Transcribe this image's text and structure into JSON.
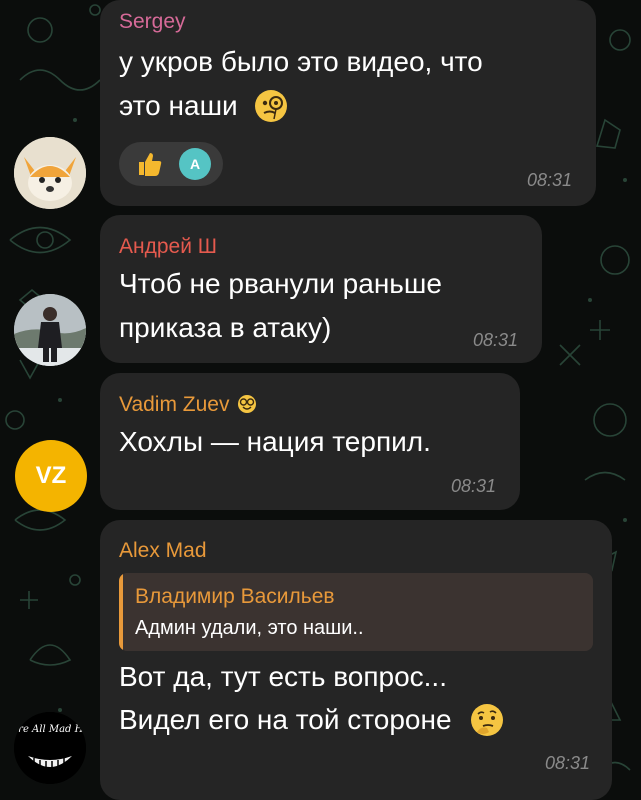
{
  "colors": {
    "background": "#0b0d0c",
    "bubble": "#252525",
    "sergey": "#d66a98",
    "andrey": "#e55a4e",
    "vadim": "#e8993a",
    "alex": "#e8993a",
    "reply_name": "#e8993a",
    "reply_bar": "#e8993a",
    "avatar_vz": "#f4b400",
    "reaction_avatar": "#55c4c4"
  },
  "messages": [
    {
      "sender": "Sergey",
      "lines": [
        "у укров было это видео, что",
        "это наши"
      ],
      "emoji": "monocle-face-icon",
      "reactions": [
        {
          "icon": "thumbs-up-icon"
        },
        {
          "avatar_letter": "A"
        }
      ],
      "time": "08:31"
    },
    {
      "sender": "Андрей Ш",
      "lines": [
        "Чтоб не рванули раньше",
        "приказа в атаку)"
      ],
      "time": "08:31"
    },
    {
      "sender": "Vadim Zuev",
      "sender_badge": "nerd-face-icon",
      "avatar_initials": "VZ",
      "lines": [
        "Хохлы — нация терпил."
      ],
      "time": "08:31"
    },
    {
      "sender": "Alex Mad",
      "avatar_caption": "We're All Mad Here",
      "reply": {
        "name": "Владимир Васильев",
        "text": "Админ удали, это наши.."
      },
      "lines": [
        "Вот да, тут есть вопрос...",
        "Видел его на той стороне"
      ],
      "emoji": "thinking-face-icon",
      "time": "08:31"
    }
  ]
}
